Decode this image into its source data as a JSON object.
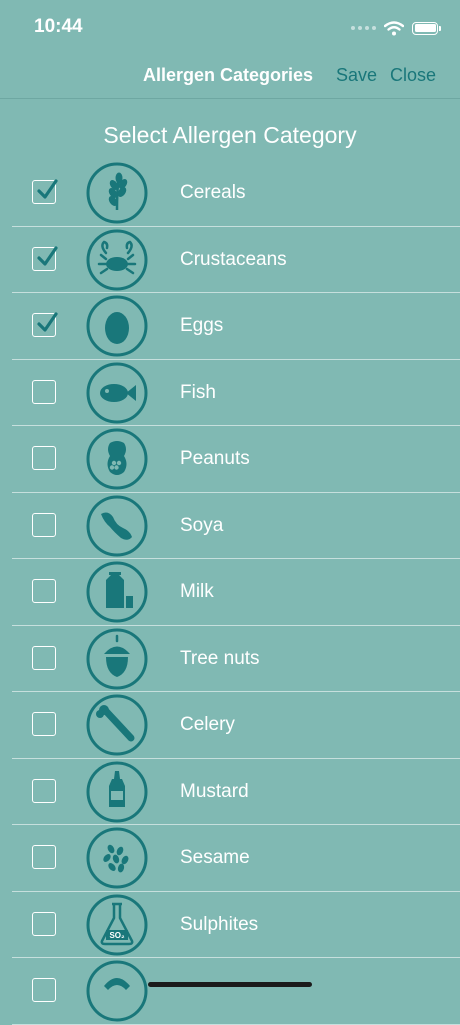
{
  "status_bar": {
    "time": "10:44"
  },
  "nav": {
    "title": "Allergen Categories",
    "save_label": "Save",
    "close_label": "Close"
  },
  "section_title": "Select Allergen Category",
  "items": [
    {
      "label": "Cereals",
      "checked": true,
      "icon": "wheat-icon"
    },
    {
      "label": "Crustaceans",
      "checked": true,
      "icon": "crab-icon"
    },
    {
      "label": "Eggs",
      "checked": true,
      "icon": "egg-icon"
    },
    {
      "label": "Fish",
      "checked": false,
      "icon": "fish-icon"
    },
    {
      "label": "Peanuts",
      "checked": false,
      "icon": "peanut-icon"
    },
    {
      "label": "Soya",
      "checked": false,
      "icon": "soybean-icon"
    },
    {
      "label": "Milk",
      "checked": false,
      "icon": "milk-icon"
    },
    {
      "label": "Tree nuts",
      "checked": false,
      "icon": "tree-nut-icon"
    },
    {
      "label": "Celery",
      "checked": false,
      "icon": "celery-icon"
    },
    {
      "label": "Mustard",
      "checked": false,
      "icon": "mustard-icon"
    },
    {
      "label": "Sesame",
      "checked": false,
      "icon": "sesame-icon"
    },
    {
      "label": "Sulphites",
      "checked": false,
      "icon": "sulphites-icon",
      "icon_text": "SO₂"
    },
    {
      "label": "",
      "checked": false,
      "icon": "lupin-icon"
    }
  ],
  "colors": {
    "background": "#80b9b3",
    "accent": "#19777a",
    "text": "#ffffff"
  }
}
